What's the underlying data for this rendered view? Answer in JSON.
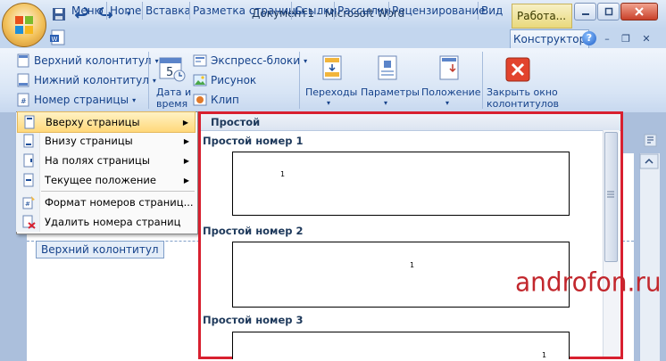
{
  "window": {
    "title": "Документ1 - Microsoft Word",
    "context_tab_title": "Работа..."
  },
  "tabs": [
    {
      "label": "Меню"
    },
    {
      "label": "Home"
    },
    {
      "label": "Вставка"
    },
    {
      "label": "Разметка страницы"
    },
    {
      "label": "Ссылки"
    },
    {
      "label": "Рассылки"
    },
    {
      "label": "Рецензирование"
    },
    {
      "label": "Вид"
    },
    {
      "label": "Конструктор"
    }
  ],
  "ribbon": {
    "header_footer": {
      "header": "Верхний колонтитул",
      "footer": "Нижний колонтитул",
      "page_number": "Номер страницы"
    },
    "date_time": {
      "line1": "Дата и",
      "line2": "время"
    },
    "insert": {
      "quick_parts": "Экспресс-блоки",
      "picture": "Рисунок",
      "clip": "Клип"
    },
    "navigation": {
      "label": "Переходы"
    },
    "options": {
      "label": "Параметры"
    },
    "position": {
      "label": "Положение"
    },
    "close": {
      "line1": "Закрыть окно",
      "line2": "колонтитулов"
    }
  },
  "menu": {
    "items": [
      {
        "label": "Вверху страницы",
        "submenu": true,
        "highlighted": true
      },
      {
        "label": "Внизу страницы",
        "submenu": true
      },
      {
        "label": "На полях страницы",
        "submenu": true
      },
      {
        "label": "Текущее положение",
        "submenu": true
      },
      {
        "label": "Формат номеров страниц...",
        "submenu": false
      },
      {
        "label": "Удалить номера страниц",
        "submenu": false
      }
    ]
  },
  "gallery": {
    "section": "Простой",
    "items": [
      {
        "label": "Простой номер 1",
        "number": "1"
      },
      {
        "label": "Простой номер 2",
        "number": "1"
      },
      {
        "label": "Простой номер 3",
        "number": "1"
      }
    ]
  },
  "document": {
    "header_tag": "Верхний колонтитул"
  },
  "watermark": "androfon.ru",
  "colors": {
    "highlight_border": "#d8202f",
    "ribbon_text": "#15428b",
    "watermark": "#c2272d"
  }
}
